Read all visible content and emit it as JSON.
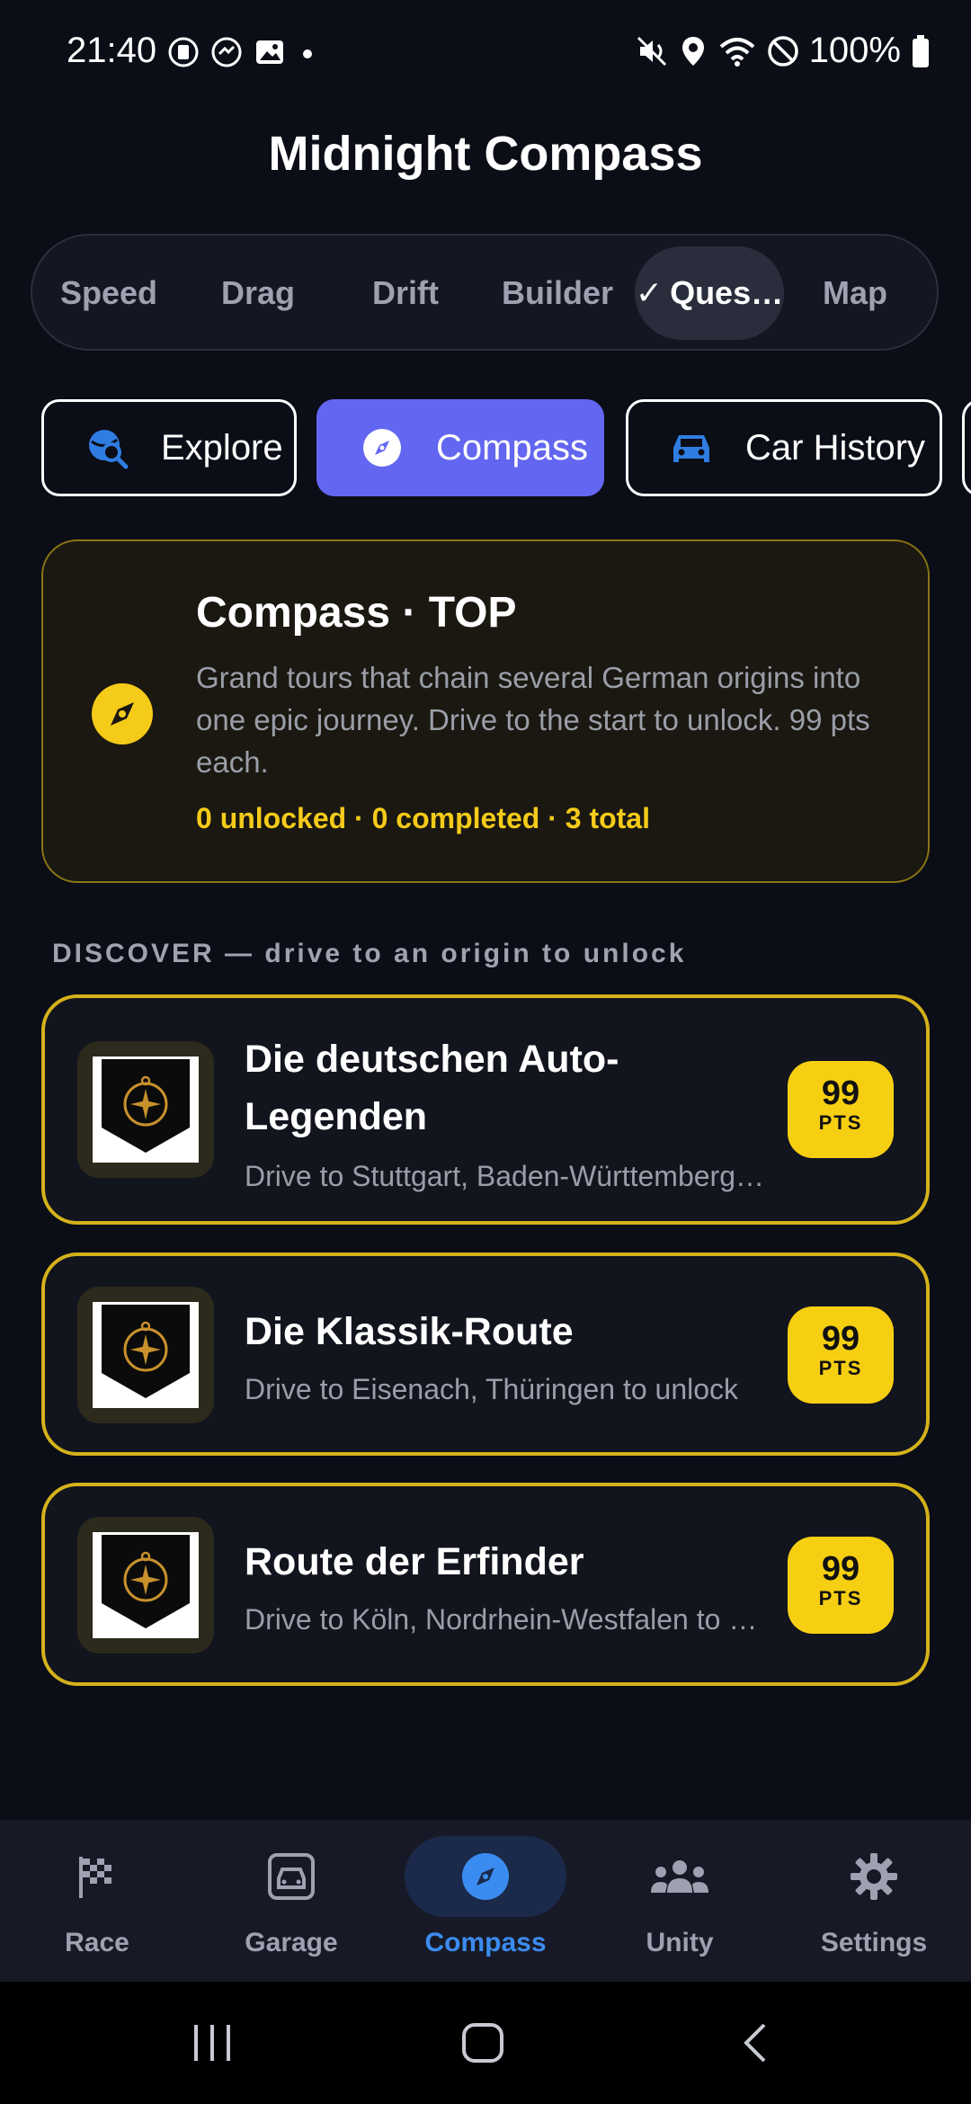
{
  "status_bar": {
    "time": "21:40",
    "battery_text": "100%",
    "icons_left": [
      "notification-icon",
      "messenger-icon",
      "gallery-icon",
      "dot-icon"
    ],
    "icons_right": [
      "mute-icon",
      "location-icon",
      "wifi-icon",
      "dnd-icon",
      "battery-icon"
    ]
  },
  "app": {
    "title": "Midnight Compass"
  },
  "mode_tabs": [
    {
      "label": "Speed",
      "active": false
    },
    {
      "label": "Drag",
      "active": false
    },
    {
      "label": "Drift",
      "active": false
    },
    {
      "label": "Builder",
      "active": false
    },
    {
      "label": "Ques…",
      "active": true,
      "check": "✓"
    },
    {
      "label": "Map",
      "active": false
    }
  ],
  "chips": [
    {
      "label": "Explore",
      "icon": "globe-search-icon",
      "active": false
    },
    {
      "label": "Compass",
      "icon": "compass-icon",
      "active": true
    },
    {
      "label": "Car History",
      "icon": "car-icon",
      "active": false
    }
  ],
  "info_card": {
    "title": "Compass · TOP",
    "description": "Grand tours that chain several German origins into one epic journey. Drive to the start to unlock. 99 pts each.",
    "stats": "0 unlocked · 0 completed · 3 total",
    "icon": "compass-icon"
  },
  "section_label": "DISCOVER — drive to an origin to unlock",
  "quests": [
    {
      "title": "Die deutschen Auto-Legenden",
      "subtitle": "Drive to Stuttgart, Baden-Württemberg to unlock",
      "points": "99",
      "unit": "PTS"
    },
    {
      "title": "Die Klassik-Route",
      "subtitle": "Drive to Eisenach, Thüringen to unlock",
      "points": "99",
      "unit": "PTS"
    },
    {
      "title": "Route der Erfinder",
      "subtitle": "Drive to Köln, Nordrhein-Westfalen to unlock",
      "points": "99",
      "unit": "PTS"
    }
  ],
  "bottom_nav": [
    {
      "label": "Race",
      "icon": "checkered-flag-icon",
      "active": false
    },
    {
      "label": "Garage",
      "icon": "garage-icon",
      "active": false
    },
    {
      "label": "Compass",
      "icon": "compass-icon",
      "active": true
    },
    {
      "label": "Unity",
      "icon": "group-icon",
      "active": false
    },
    {
      "label": "Settings",
      "icon": "gear-icon",
      "active": false
    }
  ],
  "colors": {
    "background": "#0b0d17",
    "accent_purple": "#6366f1",
    "gold": "#f5cb1a",
    "nav_active": "#3b8cf0"
  }
}
